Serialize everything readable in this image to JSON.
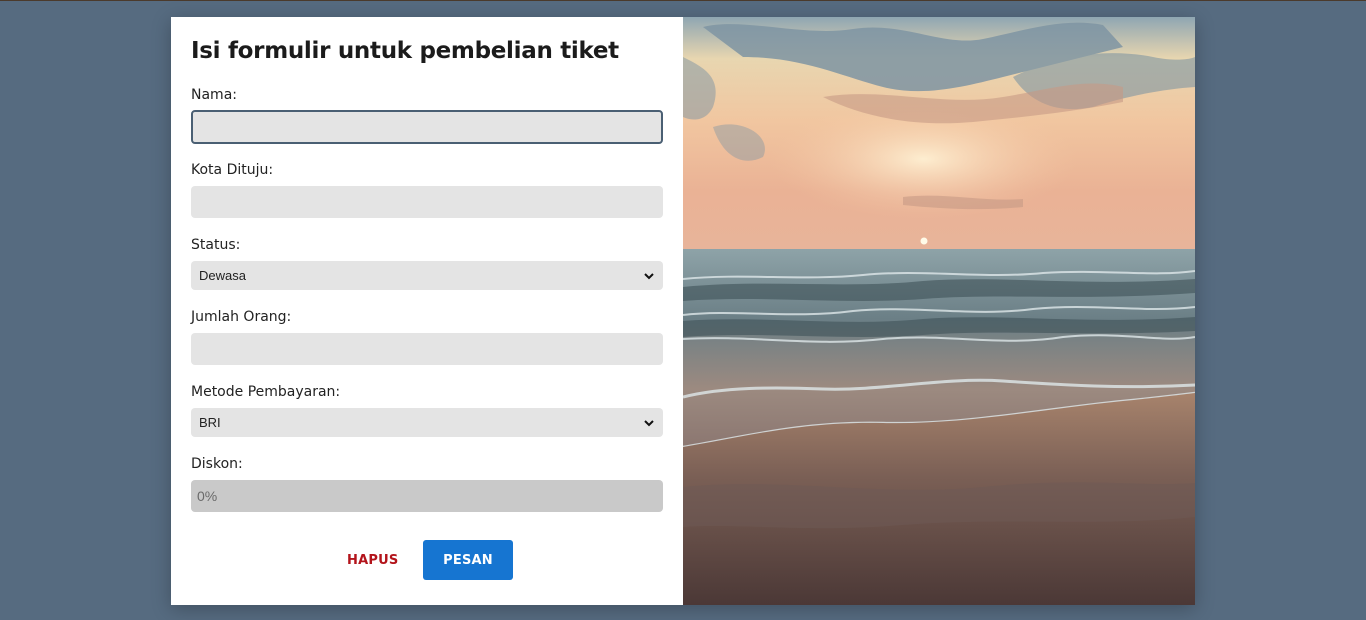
{
  "form": {
    "title": "Isi formulir untuk pembelian tiket",
    "fields": {
      "nama": {
        "label": "Nama:",
        "value": ""
      },
      "kota": {
        "label": "Kota Dituju:",
        "value": ""
      },
      "status": {
        "label": "Status:",
        "selected": "Dewasa"
      },
      "jumlah": {
        "label": "Jumlah Orang:",
        "value": ""
      },
      "metode": {
        "label": "Metode Pembayaran:",
        "selected": "BRI"
      },
      "diskon": {
        "label": "Diskon:",
        "placeholder": "0%"
      }
    },
    "buttons": {
      "reset": "HAPUS",
      "submit": "PESAN"
    }
  },
  "colors": {
    "page_background": "#566b80",
    "submit_button": "#1675d1",
    "reset_text": "#b3141b",
    "input_background": "#e4e4e4",
    "disabled_input": "#c9c9c9"
  },
  "image": {
    "description_icon": "beach-sunset-photo"
  }
}
